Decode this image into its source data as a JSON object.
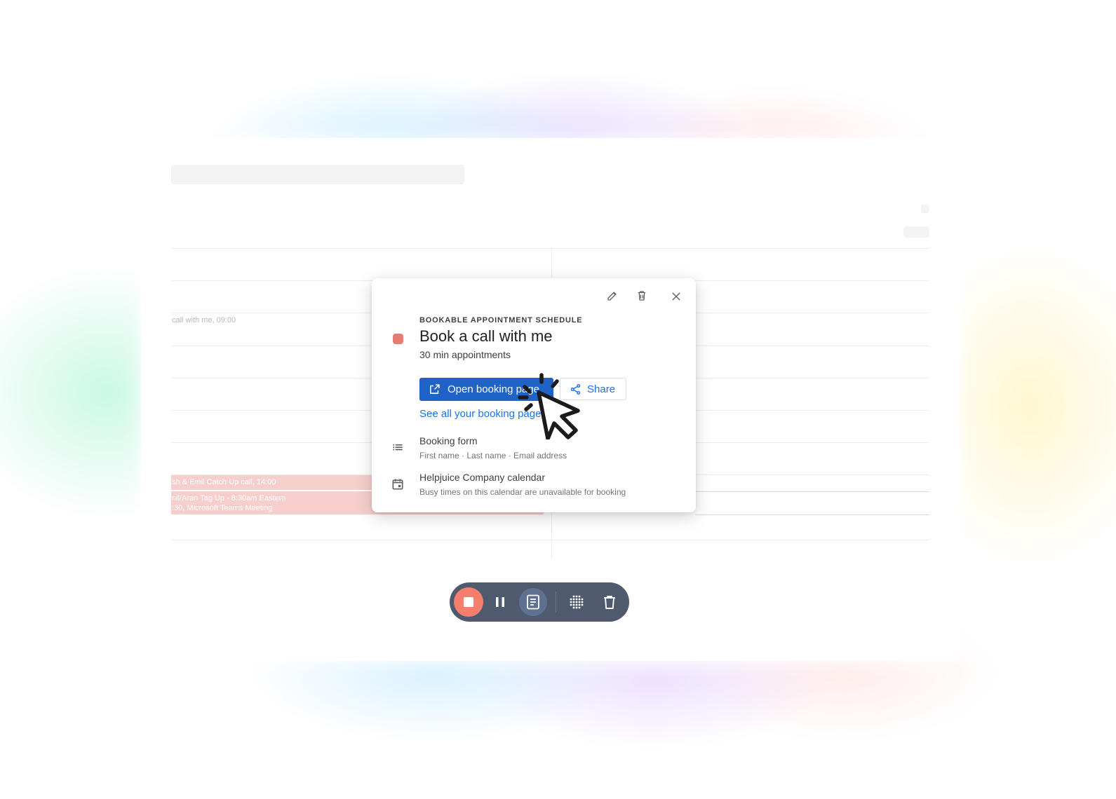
{
  "calendar_background": {
    "event_snippet_left": "call with me, 09:00",
    "events": [
      "sh & Emil Catch Up call, 14:00",
      "nil/Aran Tag Up - 8:30am Eastern",
      ":30, Microsoft Teams Meeting"
    ],
    "event_color": "#f6cfcd"
  },
  "popover": {
    "eyebrow": "BOOKABLE APPOINTMENT SCHEDULE",
    "title": "Book a call with me",
    "subtitle": "30 min appointments",
    "color": "#e67c73",
    "icons": [
      "edit-icon",
      "delete-icon",
      "close-icon"
    ],
    "primary_button": "Open booking page",
    "share_button": "Share",
    "link": "See all your booking pages",
    "booking_form": {
      "title": "Booking form",
      "subtitle": "First name · Last name · Email address"
    },
    "calendar": {
      "title": "Helpjuice Company calendar",
      "subtitle": "Busy times on this calendar are unavailable for booking"
    },
    "accent": "#1a73e8"
  },
  "recorder_toolbar": {
    "buttons": [
      "stop-icon",
      "pause-icon",
      "notes-icon",
      "grid-icon",
      "trash-icon"
    ],
    "background": "#4f5a6e",
    "stop_color": "#f57f6c"
  }
}
